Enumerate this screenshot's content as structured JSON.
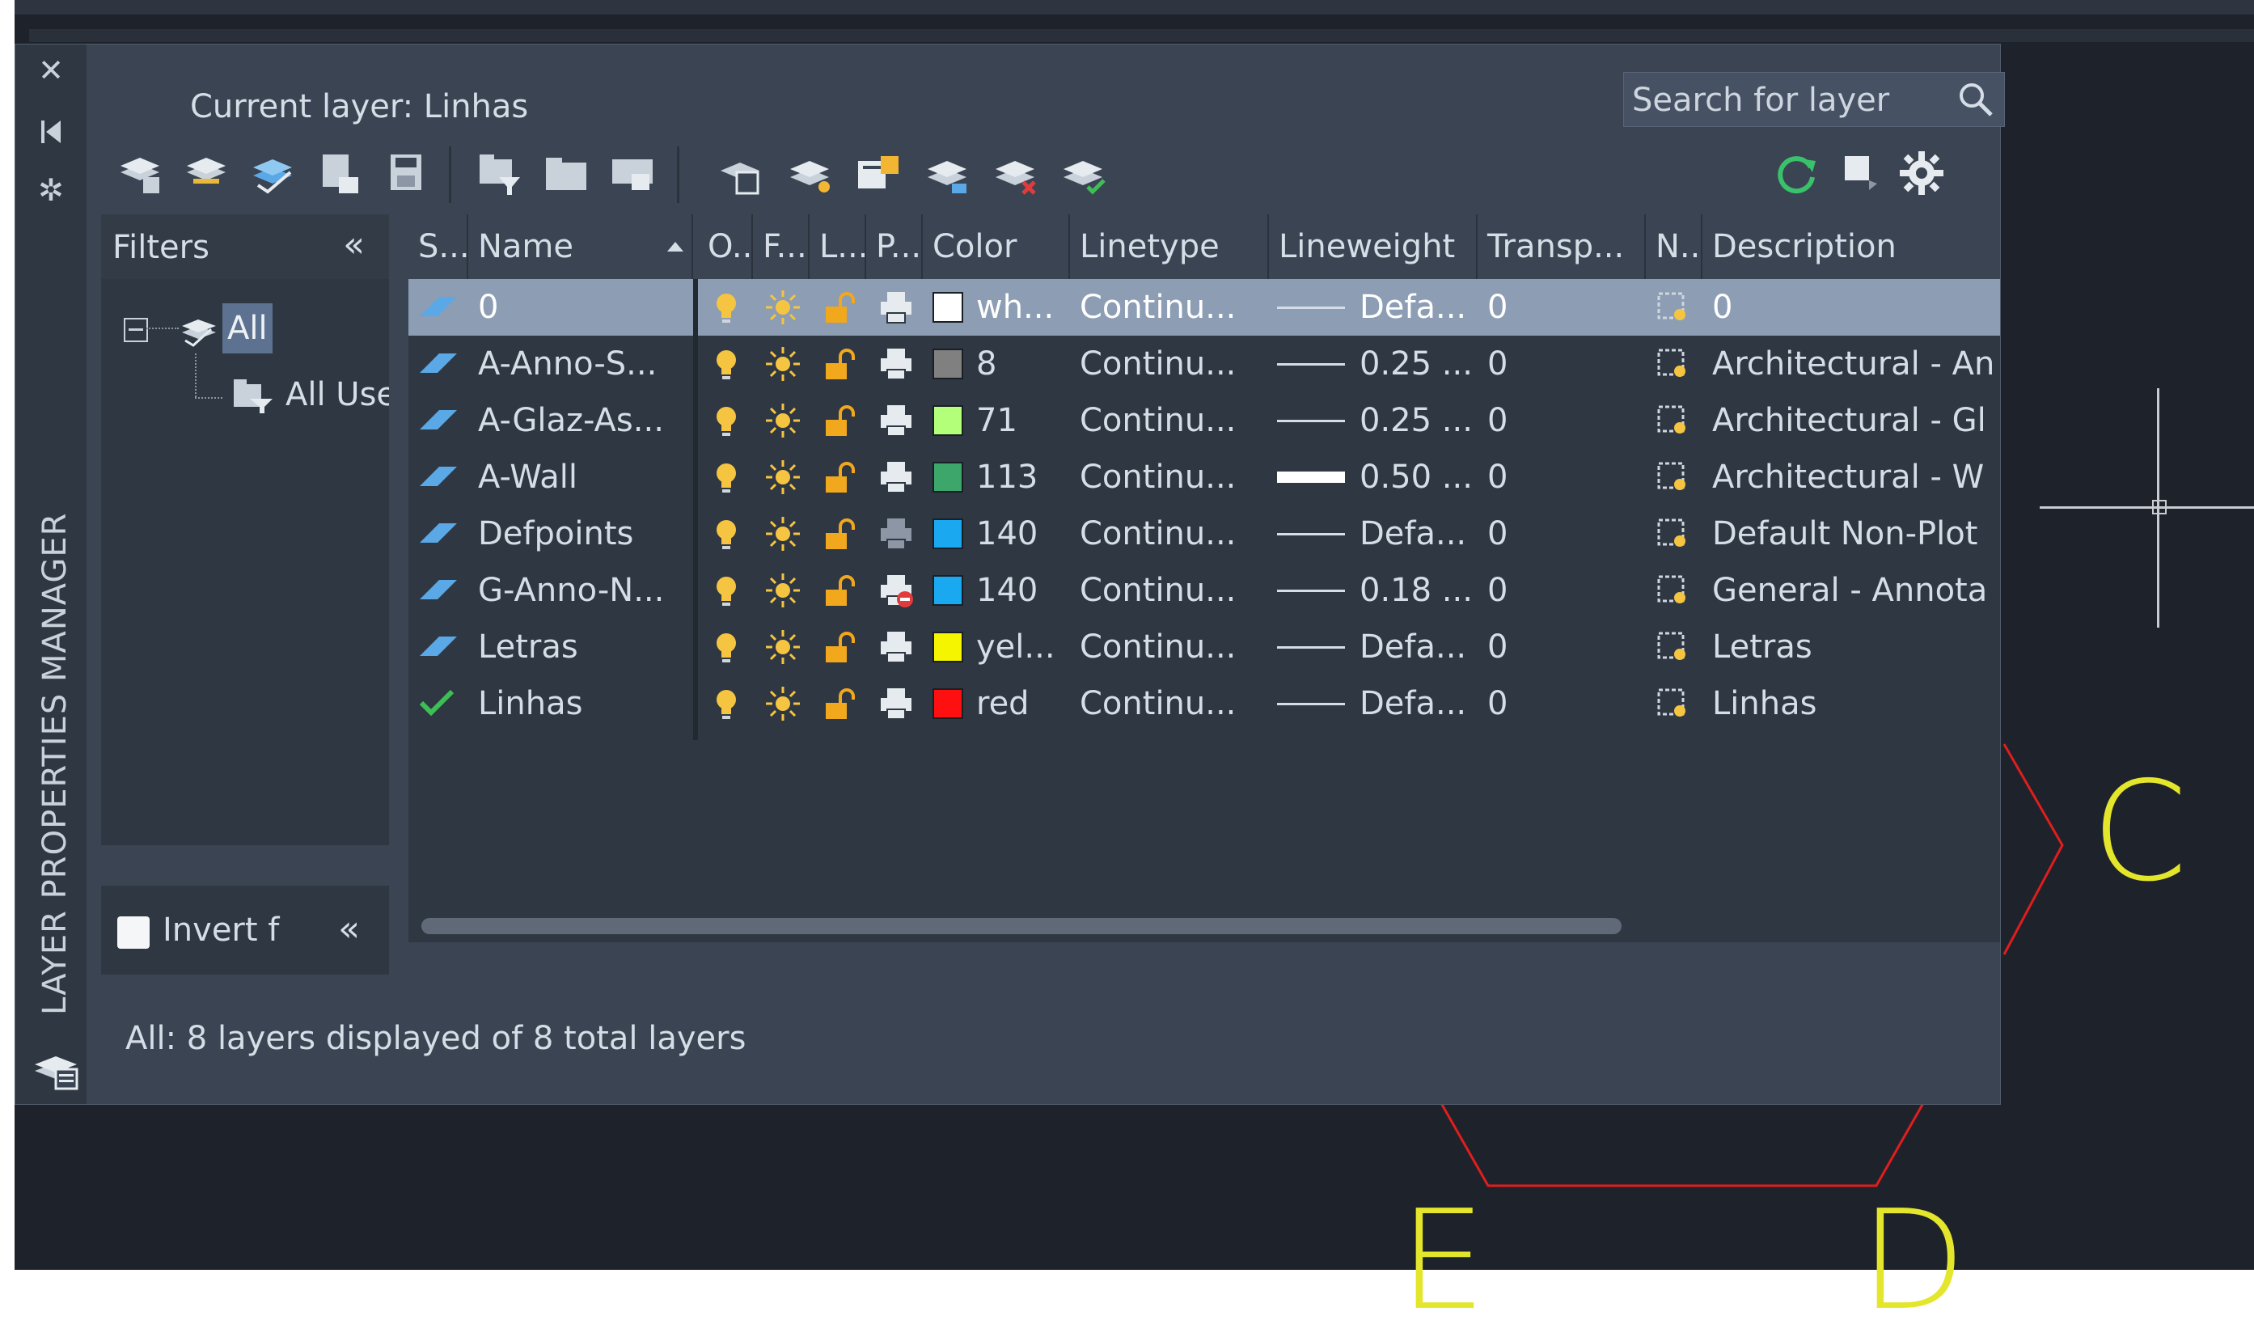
{
  "palette": {
    "side_title": "LAYER PROPERTIES MANAGER",
    "current_layer": "Current layer: Linhas",
    "search_placeholder": "Search for layer",
    "filters": {
      "title": "Filters",
      "collapse_label": "«",
      "tree_all": "All",
      "tree_all_used": "All Used Layers",
      "invert_label": "Invert f",
      "invert_collapse": "«"
    },
    "columns": [
      "S...",
      "Name",
      "O..",
      "F...",
      "L...",
      "P...",
      "Color",
      "Linetype",
      "Lineweight",
      "Transp...",
      "N..",
      "Description"
    ],
    "rows": [
      {
        "status": "current",
        "name": "0",
        "color_name": "wh...",
        "color_hex": "#ffffff",
        "linetype": "Continu...",
        "lineweight": "Defa...",
        "lw_thick": false,
        "transparency": "0",
        "description": "0",
        "plot": "print",
        "selected": true
      },
      {
        "status": "layer",
        "name": "A-Anno-S...",
        "color_name": "8",
        "color_hex": "#808080",
        "linetype": "Continu...",
        "lineweight": "0.25 ...",
        "lw_thick": false,
        "transparency": "0",
        "description": "Architectural - An",
        "plot": "print",
        "selected": false
      },
      {
        "status": "layer",
        "name": "A-Glaz-As...",
        "color_name": "71",
        "color_hex": "#b4ff7a",
        "linetype": "Continu...",
        "lineweight": "0.25 ...",
        "lw_thick": false,
        "transparency": "0",
        "description": "Architectural - Gl",
        "plot": "print",
        "selected": false
      },
      {
        "status": "layer",
        "name": "A-Wall",
        "color_name": "113",
        "color_hex": "#3da66b",
        "linetype": "Continu...",
        "lineweight": "0.50 ...",
        "lw_thick": true,
        "transparency": "0",
        "description": "Architectural - W",
        "plot": "print",
        "selected": false
      },
      {
        "status": "layer",
        "name": "Defpoints",
        "color_name": "140",
        "color_hex": "#1aa8f0",
        "linetype": "Continu...",
        "lineweight": "Defa...",
        "lw_thick": false,
        "transparency": "0",
        "description": "Default Non-Plot",
        "plot": "noplot-grey",
        "selected": false
      },
      {
        "status": "layer",
        "name": "G-Anno-N...",
        "color_name": "140",
        "color_hex": "#1aa8f0",
        "linetype": "Continu...",
        "lineweight": "0.18 ...",
        "lw_thick": false,
        "transparency": "0",
        "description": "General - Annota",
        "plot": "noplot-red",
        "selected": false
      },
      {
        "status": "layer",
        "name": "Letras",
        "color_name": "yel...",
        "color_hex": "#f5f500",
        "linetype": "Continu...",
        "lineweight": "Defa...",
        "lw_thick": false,
        "transparency": "0",
        "description": "Letras",
        "plot": "print",
        "selected": false
      },
      {
        "status": "current-check",
        "name": "Linhas",
        "color_name": "red",
        "color_hex": "#ff1010",
        "linetype": "Continu...",
        "lineweight": "Defa...",
        "lw_thick": false,
        "transparency": "0",
        "description": "Linhas",
        "plot": "print",
        "selected": false
      }
    ],
    "status_bar": "All: 8 layers displayed of 8 total layers"
  },
  "canvas": {
    "letters": [
      "C",
      "E",
      "D"
    ],
    "colors": {
      "geometry_red": "#e11d1d",
      "text_yellow": "#e3e62b",
      "background": "#1e232b"
    }
  },
  "icons": [
    "close-icon",
    "auto-hide-icon",
    "settings-icon",
    "refresh-icon",
    "gear-icon",
    "search-icon",
    "lightbulb-icon",
    "sun-icon",
    "unlock-icon",
    "printer-icon"
  ]
}
